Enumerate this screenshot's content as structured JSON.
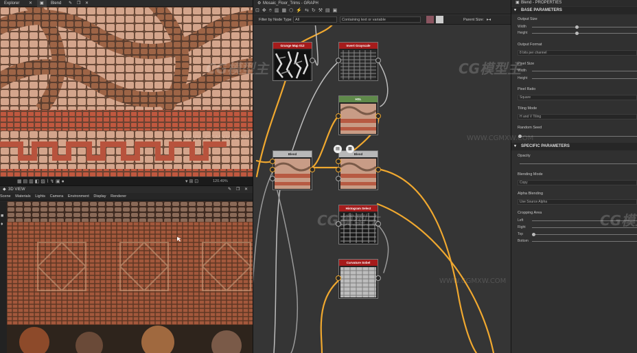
{
  "tabs": {
    "explorer": "Explorer",
    "blend_2d": "Blend",
    "view3d": "3D VIEW"
  },
  "view2d": {
    "zoom": "120.49%"
  },
  "view3d": {
    "menu": [
      "Scene",
      "Materials",
      "Lights",
      "Camera",
      "Environment",
      "Display",
      "Renderer"
    ]
  },
  "graph": {
    "title": "Mosaic_Floor_Trims - GRAPH",
    "filter_label": "Filter by Node Type",
    "filter_value": "All",
    "search_placeholder": "Containing text or variable",
    "parent_size_label": "Parent Size:",
    "nodes": {
      "grunge": "Grunge Map 012",
      "invert": "Invert Grayscale",
      "hsl": "HSL",
      "blend_left": "Blend",
      "blend_right": "Blend",
      "histogram": "Histogram Select",
      "curvature": "Curvature Sobel"
    }
  },
  "props": {
    "title": "Blend - PROPERTIES",
    "base_section": "BASE PARAMETERS",
    "output_size": "Output Size",
    "width": "Width",
    "height": "Height",
    "output_format": "Output Format",
    "output_format_value": "8 bits per channel",
    "pixel_size": "Pixel Size",
    "pixel_size_width": "Width",
    "pixel_size_height": "Height",
    "pixel_ratio": "Pixel Ratio",
    "pixel_ratio_value": "Square",
    "tiling_mode": "Tiling Mode",
    "tiling_mode_value": "H and V Tiling",
    "random_seed": "Random Seed",
    "specific_section": "SPECIFIC PARAMETERS",
    "opacity": "Opacity",
    "blending_mode": "Blending Mode",
    "blending_mode_value": "Copy",
    "alpha_blending": "Alpha Blending",
    "alpha_blending_value": "Use Source Alpha",
    "cropping_area": "Cropping Area",
    "left": "Left",
    "right": "Right",
    "top": "Top",
    "bottom": "Bottom"
  },
  "watermarks": {
    "logo": "CG模型主",
    "url": "WWW.CGMXW.COM"
  },
  "colors": {
    "accent": "#f0a82f",
    "node_red": "#a61c1c",
    "node_green": "#5f8a4a",
    "node_gray": "#b8b8b8"
  }
}
